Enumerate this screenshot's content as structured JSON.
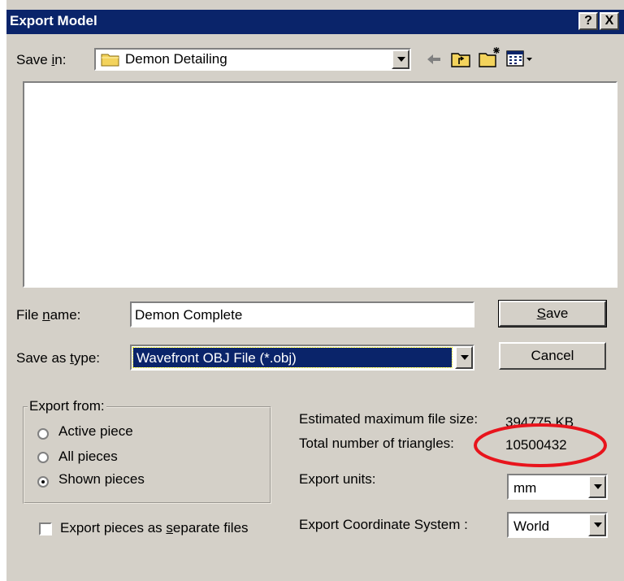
{
  "window": {
    "title": "Export Model",
    "help_button": "?",
    "close_button": "X"
  },
  "save_in": {
    "label_pre": "Save ",
    "label_u": "i",
    "label_post": "n:",
    "value": "Demon Detailing"
  },
  "file_name": {
    "label_pre": "File ",
    "label_u": "n",
    "label_post": "ame:",
    "value": "Demon Complete"
  },
  "save_as_type": {
    "label_pre": "Save as ",
    "label_u": "t",
    "label_post": "ype:",
    "value": "Wavefront OBJ File (*.obj)"
  },
  "buttons": {
    "save_u": "S",
    "save_rest": "ave",
    "cancel": "Cancel"
  },
  "export_from": {
    "title": "Export from:",
    "options": [
      "Active piece",
      "All pieces",
      "Shown pieces"
    ],
    "selected": "Shown pieces"
  },
  "separate_files": {
    "label_pre": "Export pieces as ",
    "label_u": "s",
    "label_post": "eparate files",
    "checked": false
  },
  "stats": {
    "file_size_label": "Estimated maximum file size:",
    "file_size_value": "394775 KB",
    "triangles_label": "Total number of triangles:",
    "triangles_value": "10500432"
  },
  "export_units": {
    "label": "Export units:",
    "value": "mm"
  },
  "coordinate_system": {
    "label": "Export Coordinate System :",
    "value": "World"
  },
  "colors": {
    "titlebar": "#0a246a",
    "dialog_bg": "#d4d0c8",
    "selection": "#0a246a",
    "annotation_circle": "#e8141c"
  }
}
